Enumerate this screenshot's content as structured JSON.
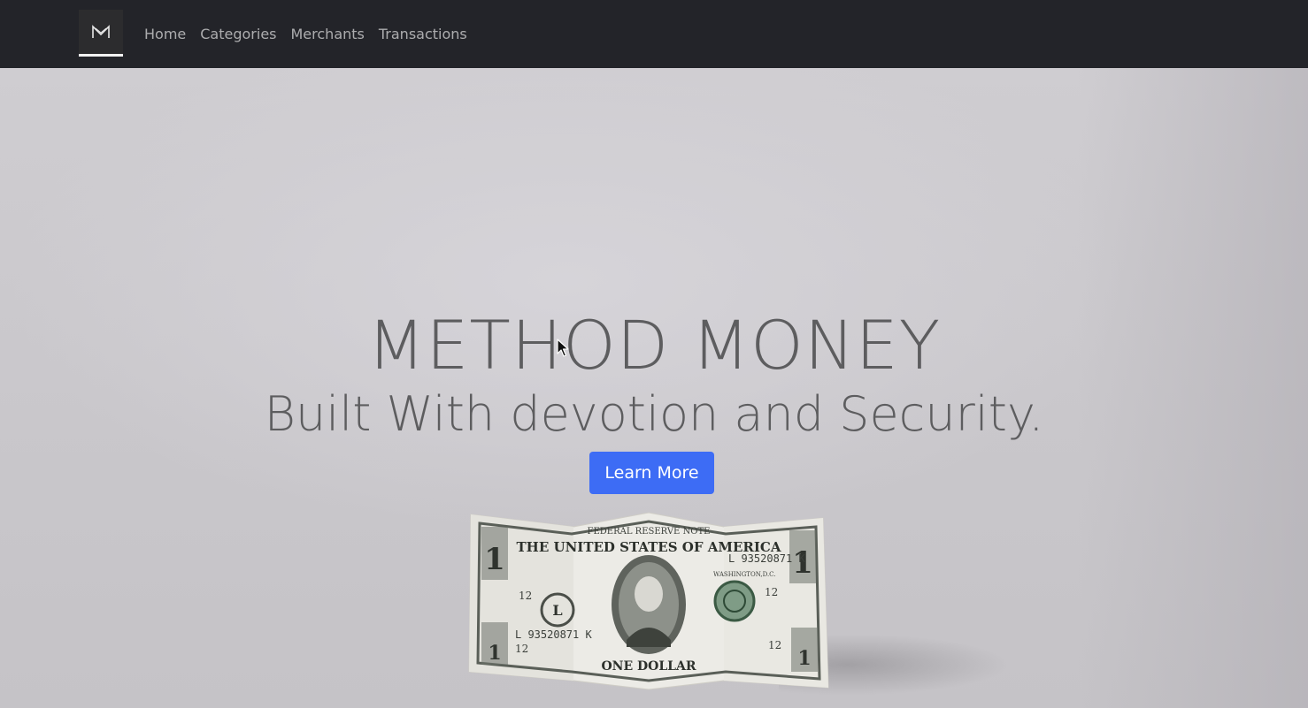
{
  "navbar": {
    "brand_icon": "method-money-logo-icon",
    "links": [
      {
        "label": "Home"
      },
      {
        "label": "Categories"
      },
      {
        "label": "Merchants"
      },
      {
        "label": "Transactions"
      }
    ]
  },
  "hero": {
    "title": "METHOD MONEY",
    "subtitle": "Built With devotion and Security.",
    "cta_label": "Learn More",
    "image": "one-dollar-bill-icon",
    "bill_text": {
      "top": "FEDERAL RESERVE NOTE",
      "country": "THE UNITED STATES OF AMERICA",
      "serial": "L 93520871 K",
      "denomination": "ONE DOLLAR",
      "city": "WASHINGTON,D.C.",
      "corner": "1",
      "twelve": "12",
      "letter": "L"
    }
  },
  "colors": {
    "navbar_bg": "#232429",
    "cta_bg": "#3d6cf5",
    "hero_text": "#5d5d5f"
  }
}
